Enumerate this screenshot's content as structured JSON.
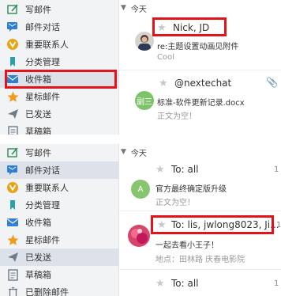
{
  "top": {
    "sidebar": {
      "items": [
        {
          "label": "写邮件",
          "icon": "compose-icon"
        },
        {
          "label": "邮件对话",
          "icon": "conversation-icon"
        },
        {
          "label": "重要联系人",
          "icon": "vip-contact-icon"
        },
        {
          "label": "分类管理",
          "icon": "category-icon"
        },
        {
          "label": "收件箱",
          "icon": "inbox-icon"
        },
        {
          "label": "星标邮件",
          "icon": "star-icon"
        },
        {
          "label": "已发送",
          "icon": "sent-icon"
        },
        {
          "label": "草稿箱",
          "icon": "draft-icon"
        }
      ],
      "active_index": 4
    },
    "day_label": "今天",
    "mails": [
      {
        "sender": "Nick, JD",
        "subject": "re:主题设置动画见附件",
        "preview": "Cool"
      },
      {
        "sender": "@nextechat",
        "subject": "标准-软件更新记录.docx",
        "preview": "正文为空！",
        "avatar_text": "副三"
      }
    ]
  },
  "bottom": {
    "sidebar": {
      "items": [
        {
          "label": "写邮件",
          "icon": "compose-icon"
        },
        {
          "label": "邮件对话",
          "icon": "conversation-icon"
        },
        {
          "label": "重要联系人",
          "icon": "vip-contact-icon"
        },
        {
          "label": "分类管理",
          "icon": "category-icon"
        },
        {
          "label": "收件箱",
          "icon": "inbox-icon"
        },
        {
          "label": "星标邮件",
          "icon": "star-icon"
        },
        {
          "label": "已发送",
          "icon": "sent-icon"
        },
        {
          "label": "草稿箱",
          "icon": "draft-icon"
        },
        {
          "label": "已删除邮件",
          "icon": "trash-icon"
        }
      ],
      "active_index": 6
    },
    "day_label": "今天",
    "mails": [
      {
        "sender": "To: all",
        "subject": "官方最终确定版升级",
        "preview": "正文为空！",
        "avatar_text": "A",
        "date": "1"
      },
      {
        "sender": "To: lis, jwlong8023, Ji...",
        "subject": "一起去看小王子！",
        "preview": "地点：田林路 庆春电影院",
        "date": "1"
      },
      {
        "sender": "To: all",
        "date": "1"
      }
    ]
  },
  "colors": {
    "highlight_border": "#e4131a",
    "sidebar_bg": "#f2f3f5",
    "active_bg": "#dde2ea",
    "avatar_green": "#7cc36a",
    "avatar_a": "#88c56f"
  }
}
